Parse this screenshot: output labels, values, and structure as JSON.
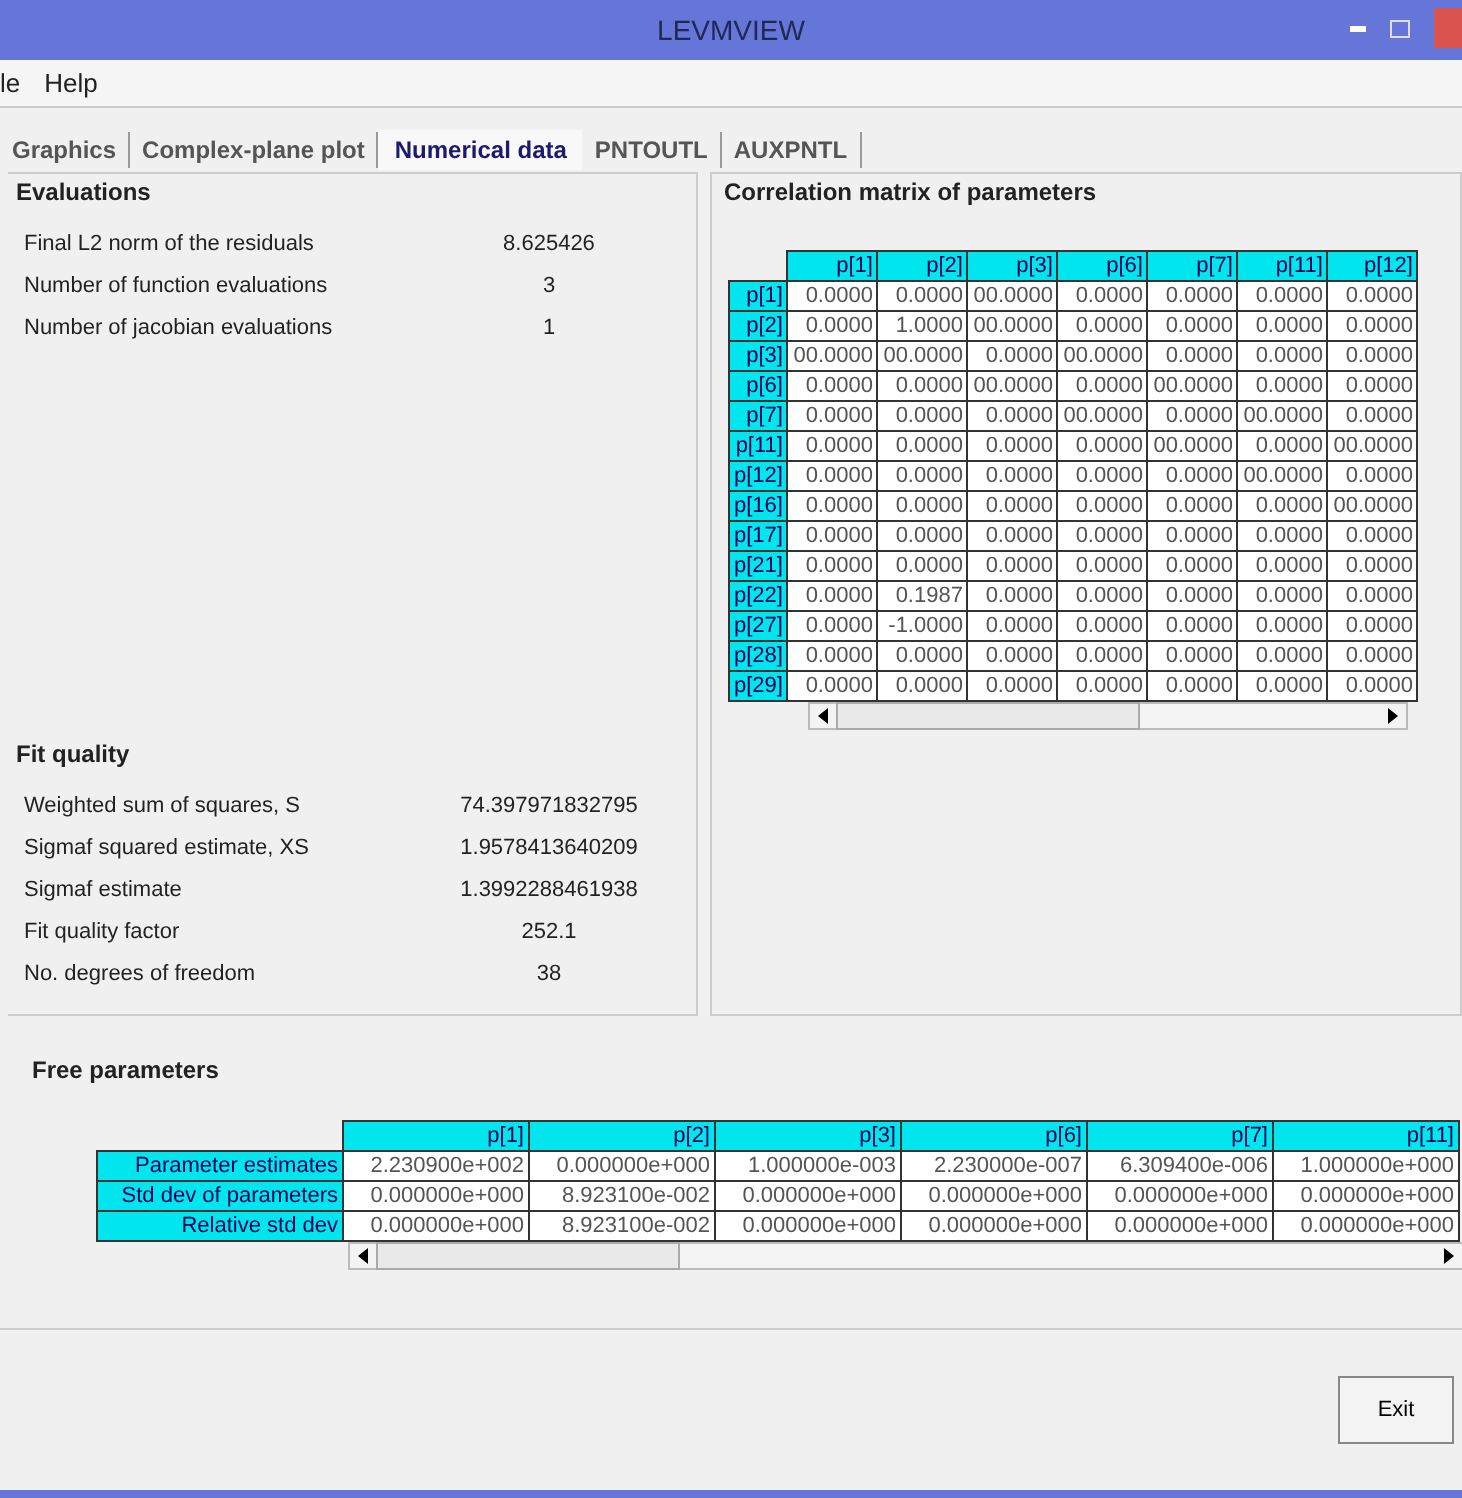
{
  "window": {
    "title": "LEVMVIEW"
  },
  "menu": [
    "le",
    "Help"
  ],
  "tabs": [
    {
      "label": "Graphics",
      "selected": false
    },
    {
      "label": "Complex-plane plot",
      "selected": false
    },
    {
      "label": "Numerical data",
      "selected": true
    },
    {
      "label": "PNTOUTL",
      "selected": false
    },
    {
      "label": "AUXPNTL",
      "selected": false
    }
  ],
  "evaluations": {
    "title": "Evaluations",
    "rows": [
      {
        "label": "Final L2 norm of the residuals",
        "value": "8.625426"
      },
      {
        "label": "Number of function evaluations",
        "value": "3"
      },
      {
        "label": "Number of jacobian evaluations",
        "value": "1"
      }
    ]
  },
  "fit_quality": {
    "title": "Fit quality",
    "rows": [
      {
        "label": "Weighted sum of squares, S",
        "value": "74.397971832795"
      },
      {
        "label": "Sigmaf squared estimate, XS",
        "value": "1.9578413640209"
      },
      {
        "label": "Sigmaf estimate",
        "value": "1.3992288461938"
      },
      {
        "label": "Fit quality factor",
        "value": "252.1"
      },
      {
        "label": "No. degrees of freedom",
        "value": "38"
      }
    ]
  },
  "correlation": {
    "title": "Correlation matrix of parameters",
    "columns": [
      "p[1]",
      "p[2]",
      "p[3]",
      "p[6]",
      "p[7]",
      "p[11]",
      "p[12]"
    ],
    "rows": [
      {
        "name": "p[1]",
        "cells": [
          "0.0000",
          "0.0000",
          "00.0000",
          "0.0000",
          "0.0000",
          "0.0000",
          "0.0000"
        ]
      },
      {
        "name": "p[2]",
        "cells": [
          "0.0000",
          "1.0000",
          "00.0000",
          "0.0000",
          "0.0000",
          "0.0000",
          "0.0000"
        ]
      },
      {
        "name": "p[3]",
        "cells": [
          "00.0000",
          "00.0000",
          "0.0000",
          "00.0000",
          "0.0000",
          "0.0000",
          "0.0000"
        ]
      },
      {
        "name": "p[6]",
        "cells": [
          "0.0000",
          "0.0000",
          "00.0000",
          "0.0000",
          "00.0000",
          "0.0000",
          "0.0000"
        ]
      },
      {
        "name": "p[7]",
        "cells": [
          "0.0000",
          "0.0000",
          "0.0000",
          "00.0000",
          "0.0000",
          "00.0000",
          "0.0000"
        ]
      },
      {
        "name": "p[11]",
        "cells": [
          "0.0000",
          "0.0000",
          "0.0000",
          "0.0000",
          "00.0000",
          "0.0000",
          "00.0000"
        ]
      },
      {
        "name": "p[12]",
        "cells": [
          "0.0000",
          "0.0000",
          "0.0000",
          "0.0000",
          "0.0000",
          "00.0000",
          "0.0000"
        ]
      },
      {
        "name": "p[16]",
        "cells": [
          "0.0000",
          "0.0000",
          "0.0000",
          "0.0000",
          "0.0000",
          "0.0000",
          "00.0000"
        ]
      },
      {
        "name": "p[17]",
        "cells": [
          "0.0000",
          "0.0000",
          "0.0000",
          "0.0000",
          "0.0000",
          "0.0000",
          "0.0000"
        ]
      },
      {
        "name": "p[21]",
        "cells": [
          "0.0000",
          "0.0000",
          "0.0000",
          "0.0000",
          "0.0000",
          "0.0000",
          "0.0000"
        ]
      },
      {
        "name": "p[22]",
        "cells": [
          "0.0000",
          "0.1987",
          "0.0000",
          "0.0000",
          "0.0000",
          "0.0000",
          "0.0000"
        ]
      },
      {
        "name": "p[27]",
        "cells": [
          "0.0000",
          "-1.0000",
          "0.0000",
          "0.0000",
          "0.0000",
          "0.0000",
          "0.0000"
        ]
      },
      {
        "name": "p[28]",
        "cells": [
          "0.0000",
          "0.0000",
          "0.0000",
          "0.0000",
          "0.0000",
          "0.0000",
          "0.0000"
        ]
      },
      {
        "name": "p[29]",
        "cells": [
          "0.0000",
          "0.0000",
          "0.0000",
          "0.0000",
          "0.0000",
          "0.0000",
          "0.0000"
        ]
      }
    ]
  },
  "free_parameters": {
    "title": "Free parameters",
    "columns": [
      "p[1]",
      "p[2]",
      "p[3]",
      "p[6]",
      "p[7]",
      "p[11]"
    ],
    "rows": [
      {
        "name": "Parameter estimates",
        "cells": [
          "2.230900e+002",
          "0.000000e+000",
          "1.000000e-003",
          "2.230000e-007",
          "6.309400e-006",
          "1.000000e+000"
        ]
      },
      {
        "name": "Std dev of parameters",
        "cells": [
          "0.000000e+000",
          "8.923100e-002",
          "0.000000e+000",
          "0.000000e+000",
          "0.000000e+000",
          "0.000000e+000"
        ]
      },
      {
        "name": "Relative std dev",
        "cells": [
          "0.000000e+000",
          "8.923100e-002",
          "0.000000e+000",
          "0.000000e+000",
          "0.000000e+000",
          "0.000000e+000"
        ]
      }
    ]
  },
  "buttons": [
    "Exit"
  ]
}
